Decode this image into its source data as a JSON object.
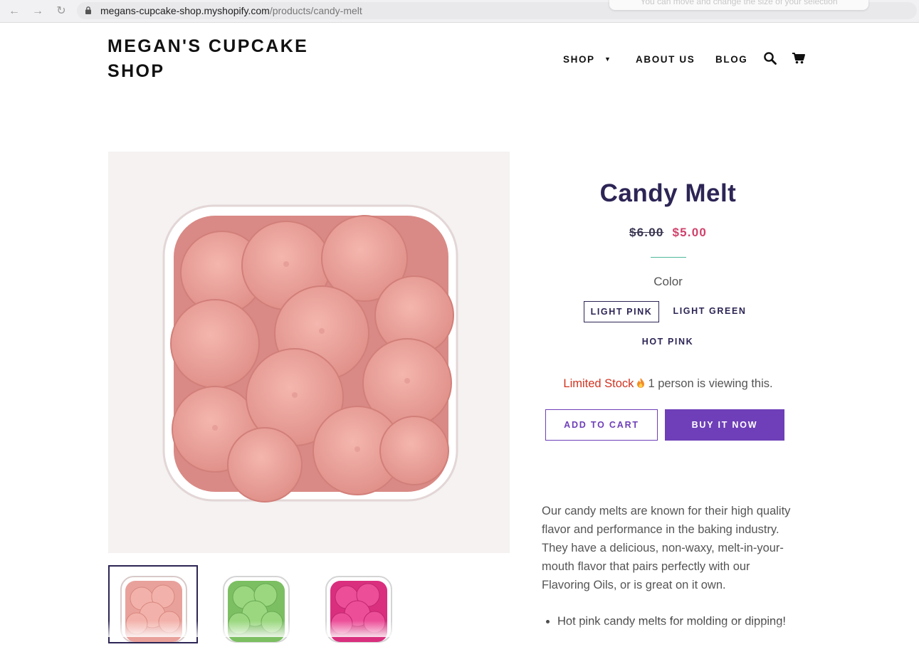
{
  "browser": {
    "url_host": "megans-cupcake-shop.myshopify.com",
    "url_path": "/products/candy-melt",
    "tooltip": "You can move and change the size of your selection"
  },
  "header": {
    "site_title": "MEGAN'S CUPCAKE SHOP",
    "nav": {
      "shop": "SHOP",
      "about": "ABOUT US",
      "blog": "BLOG"
    }
  },
  "product": {
    "title": "Candy Melt",
    "price_compare": "$6.00",
    "price_sale": "$5.00",
    "color_label": "Color",
    "colors": [
      "LIGHT PINK",
      "LIGHT GREEN",
      "HOT PINK"
    ],
    "selected_color": "LIGHT PINK",
    "stock_limited": "Limited Stock",
    "stock_viewers": "1 person is viewing this.",
    "add_to_cart": "ADD TO CART",
    "buy_now": "BUY IT NOW",
    "description": "Our candy melts are known for their high quality flavor and performance in the baking industry. They have a delicious, non-waxy, melt-in-your-mouth flavor that pairs perfectly with our Flavoring Oils, or is great on it own.",
    "bullets": [
      "Hot pink candy melts for molding or dipping!"
    ]
  },
  "colors": {
    "primary": "#2c2555",
    "accent": "#6e3fb8",
    "sale": "#d0416b",
    "stock": "#d2331f",
    "divider": "#4eb89a"
  }
}
